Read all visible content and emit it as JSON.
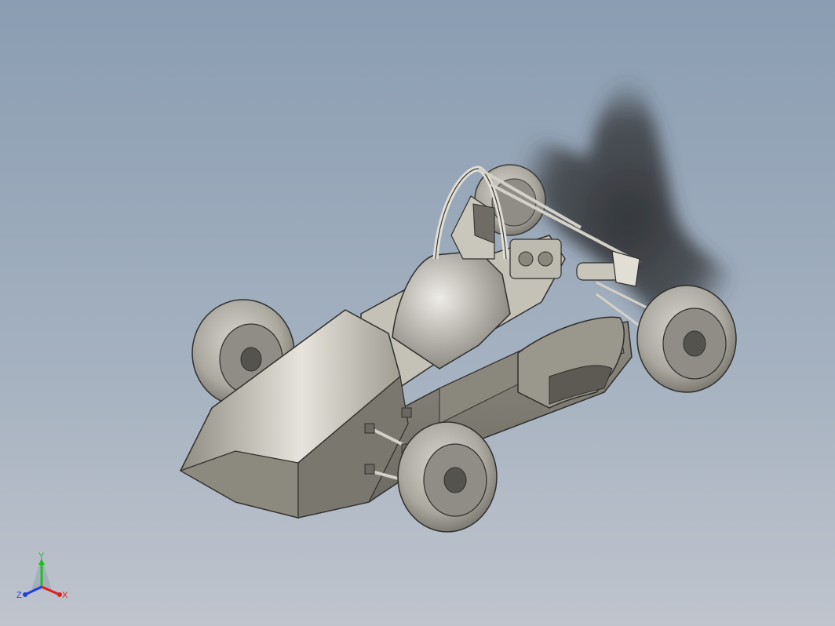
{
  "viewport": {
    "background_top": "#8a9db2",
    "background_bottom": "#bfc4cd"
  },
  "model": {
    "body_color": "#9a978c",
    "tire_color": "#b5b3aa",
    "shadow_color": "#3a3c40"
  },
  "triad": {
    "x_label": "X",
    "y_label": "Y",
    "z_label": "Z",
    "x_color": "#e02020",
    "y_color": "#20c020",
    "z_color": "#2040e0"
  }
}
